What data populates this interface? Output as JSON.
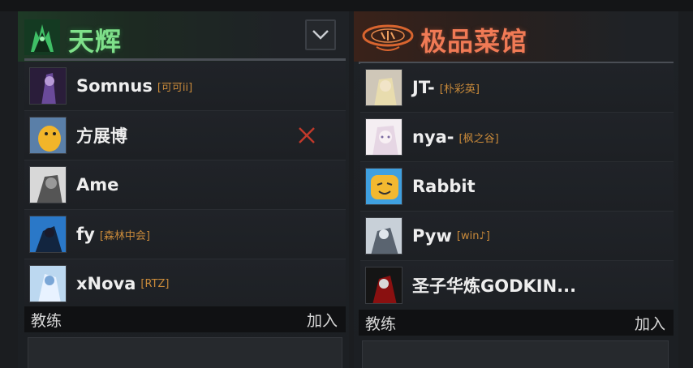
{
  "radiant": {
    "team_name": "天辉",
    "coach_label": "教练",
    "join_label": "加入",
    "players": [
      {
        "name": "Somnus",
        "tag": "[可可ii]",
        "kickable": false
      },
      {
        "name": "方展博",
        "tag": "",
        "kickable": true
      },
      {
        "name": "Ame",
        "tag": ""
      },
      {
        "name": "fy",
        "tag": "[森林中会]"
      },
      {
        "name": "xNova",
        "tag": "[RTZ]"
      }
    ]
  },
  "dire": {
    "team_name": "极品菜馆",
    "coach_label": "教练",
    "join_label": "加入",
    "players": [
      {
        "name": "JT-",
        "tag": "[朴彩英]"
      },
      {
        "name": "nya-",
        "tag": "[枫之谷]"
      },
      {
        "name": "Rabbit",
        "tag": ""
      },
      {
        "name": "Pyw",
        "tag": "[win♪]"
      },
      {
        "name": "圣子华炼GODKIN...",
        "tag": ""
      }
    ]
  },
  "colors": {
    "radiant_accent": "#7fe08a",
    "dire_accent": "#f07a55",
    "tag_color": "#c98a3a",
    "kick_color": "#c0392b"
  },
  "icons": {
    "dropdown": "chevron-down-icon",
    "kick": "close-icon"
  }
}
